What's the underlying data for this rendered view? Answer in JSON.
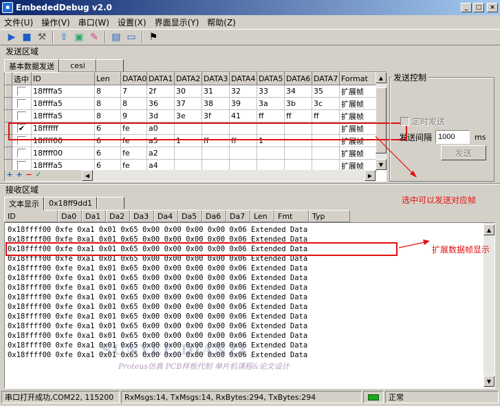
{
  "window": {
    "title": "EmbededDebug v2.0",
    "minimize": "_",
    "maximize": "□",
    "close": "×"
  },
  "menu": [
    "文件(U)",
    "操作(V)",
    "串口(W)",
    "设置(X)",
    "界面显示(Y)",
    "帮助(Z)"
  ],
  "send_section": {
    "label": "发送区域",
    "tabs": [
      "基本数据发送",
      "cesi"
    ],
    "columns": [
      "选中",
      "ID",
      "Len",
      "DATA0",
      "DATA1",
      "DATA2",
      "DATA3",
      "DATA4",
      "DATA5",
      "DATA6",
      "DATA7",
      "Format"
    ],
    "rows": [
      {
        "checked": false,
        "id": "18ffffa5",
        "len": "8",
        "d": [
          "7",
          "2f",
          "30",
          "31",
          "32",
          "33",
          "34",
          "35"
        ],
        "format": "扩展帧"
      },
      {
        "checked": false,
        "id": "18ffffa5",
        "len": "8",
        "d": [
          "8",
          "36",
          "37",
          "38",
          "39",
          "3a",
          "3b",
          "3c"
        ],
        "format": "扩展帧"
      },
      {
        "checked": false,
        "id": "18ffffa5",
        "len": "8",
        "d": [
          "9",
          "3d",
          "3e",
          "3f",
          "41",
          "ff",
          "ff",
          "ff"
        ],
        "format": "扩展帧"
      },
      {
        "checked": true,
        "id": "18ffffff",
        "len": "6",
        "d": [
          "fe",
          "a0",
          "",
          "",
          "",
          "",
          "",
          ""
        ],
        "format": "扩展帧"
      },
      {
        "checked": false,
        "id": "18ffff00",
        "len": "6",
        "d": [
          "fe",
          "a5",
          "1",
          "ff",
          "ff",
          "1",
          "",
          ""
        ],
        "format": "扩展帧"
      },
      {
        "checked": false,
        "id": "18ffff00",
        "len": "6",
        "d": [
          "fe",
          "a2",
          "",
          "",
          "",
          "",
          "",
          ""
        ],
        "format": "扩展帧"
      },
      {
        "checked": false,
        "id": "18ffffa5",
        "len": "6",
        "d": [
          "fe",
          "a4",
          "",
          "",
          "",
          "",
          "",
          ""
        ],
        "format": "扩展帧"
      }
    ],
    "add_buttons": [
      "+",
      "+",
      "−",
      "✓"
    ]
  },
  "send_control": {
    "title": "发送控制",
    "timer_send": "定时发送",
    "interval_label": "发送间隔",
    "interval_value": "1000",
    "interval_unit": "ms",
    "send_button": "发送"
  },
  "annotations": {
    "send": "选中可以发送对应帧",
    "recv": "扩展数据帧显示"
  },
  "recv_section": {
    "label": "接收区域",
    "tabs": [
      "文本显示",
      "0x18ff9dd1"
    ],
    "columns": [
      "ID",
      "Da0",
      "Da1",
      "Da2",
      "Da3",
      "Da4",
      "Da5",
      "Da6",
      "Da7",
      "Len",
      "Fmt",
      "Typ"
    ],
    "line": "0x18ffff00 0xfe 0xa1 0x01 0x65 0x00 0x00 0x00 0x00 0x06 Extended Data",
    "line_count": 14
  },
  "watermark": {
    "line1": "SUNYEE DIANZI",
    "line2": "Proteus仿真 PCB样板代制 单片机课程&论文设计"
  },
  "status": {
    "port": "串口打开成功,COM22, 115200",
    "counts": "RxMsgs:14, TxMsgs:14, RxBytes:294, TxBytes:294",
    "state": "正常"
  },
  "colors": {
    "title_start": "#0a246a",
    "title_end": "#a6caf0",
    "highlight_red": "#e01010",
    "status_led": "#1fa61f"
  }
}
